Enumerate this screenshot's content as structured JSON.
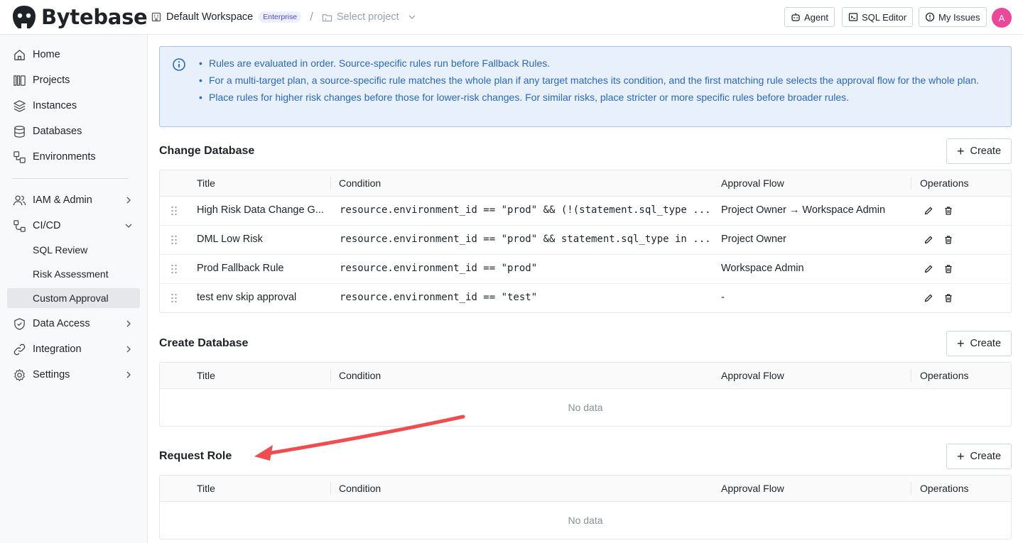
{
  "header": {
    "brand": "Bytebase",
    "workspace": "Default Workspace",
    "plan_badge": "Enterprise",
    "separator": "/",
    "project_placeholder": "Select project",
    "agent_label": "Agent",
    "sql_editor_label": "SQL Editor",
    "my_issues_label": "My Issues",
    "avatar_initial": "A"
  },
  "sidebar": {
    "items": [
      {
        "label": "Home"
      },
      {
        "label": "Projects"
      },
      {
        "label": "Instances"
      },
      {
        "label": "Databases"
      },
      {
        "label": "Environments"
      },
      {
        "label": "IAM & Admin"
      },
      {
        "label": "CI/CD"
      },
      {
        "label": "Data Access"
      },
      {
        "label": "Integration"
      },
      {
        "label": "Settings"
      }
    ],
    "cicd_sub": [
      {
        "label": "SQL Review"
      },
      {
        "label": "Risk Assessment"
      },
      {
        "label": "Custom Approval"
      }
    ]
  },
  "info": {
    "lines": [
      "Rules are evaluated in order. Source-specific rules run before Fallback Rules.",
      "For a multi-target plan, a source-specific rule matches the whole plan if any target matches its condition, and the first matching rule selects the approval flow for the whole plan.",
      "Place rules for higher risk changes before those for lower-risk changes. For similar risks, place stricter or more specific rules before broader rules."
    ]
  },
  "columns": {
    "title": "Title",
    "condition": "Condition",
    "approval_flow": "Approval Flow",
    "operations": "Operations"
  },
  "create_label": "Create",
  "no_data": "No data",
  "sections": {
    "change_database": {
      "title": "Change Database",
      "rows": [
        {
          "title": "High Risk Data Change G...",
          "condition": "resource.environment_id == \"prod\" && (!(statement.sql_type ...",
          "flow": "Project Owner → Workspace Admin"
        },
        {
          "title": "DML Low Risk",
          "condition": "resource.environment_id == \"prod\" && statement.sql_type in ...",
          "flow": "Project Owner"
        },
        {
          "title": "Prod Fallback Rule",
          "condition": "resource.environment_id == \"prod\"",
          "flow": "Workspace Admin"
        },
        {
          "title": "test env skip approval",
          "condition": "resource.environment_id == \"test\"",
          "flow": "-"
        }
      ]
    },
    "create_database": {
      "title": "Create Database"
    },
    "request_role": {
      "title": "Request Role"
    }
  },
  "colors": {
    "brand_text": "#1f2328",
    "info_bg": "#e8f0fc",
    "info_text": "#2868c6",
    "avatar_bg": "#ec4899",
    "annotation_arrow": "#ef4d50"
  }
}
